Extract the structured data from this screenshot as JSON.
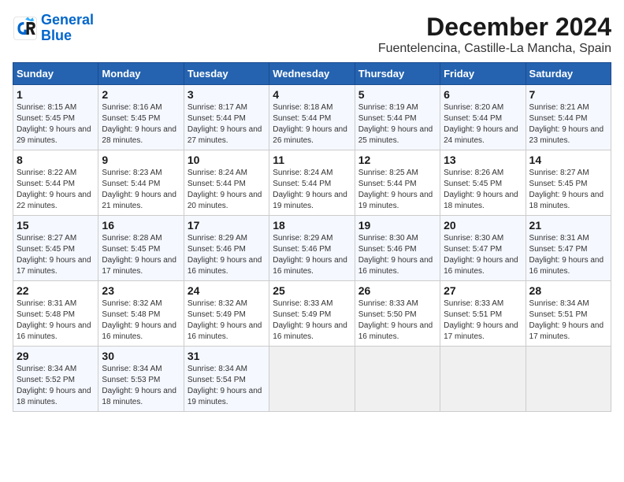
{
  "logo": {
    "line1": "General",
    "line2": "Blue"
  },
  "title": "December 2024",
  "subtitle": "Fuentelencina, Castille-La Mancha, Spain",
  "weekdays": [
    "Sunday",
    "Monday",
    "Tuesday",
    "Wednesday",
    "Thursday",
    "Friday",
    "Saturday"
  ],
  "weeks": [
    [
      {
        "day": "1",
        "sunrise": "8:15 AM",
        "sunset": "5:45 PM",
        "daylight": "9 hours and 29 minutes."
      },
      {
        "day": "2",
        "sunrise": "8:16 AM",
        "sunset": "5:45 PM",
        "daylight": "9 hours and 28 minutes."
      },
      {
        "day": "3",
        "sunrise": "8:17 AM",
        "sunset": "5:44 PM",
        "daylight": "9 hours and 27 minutes."
      },
      {
        "day": "4",
        "sunrise": "8:18 AM",
        "sunset": "5:44 PM",
        "daylight": "9 hours and 26 minutes."
      },
      {
        "day": "5",
        "sunrise": "8:19 AM",
        "sunset": "5:44 PM",
        "daylight": "9 hours and 25 minutes."
      },
      {
        "day": "6",
        "sunrise": "8:20 AM",
        "sunset": "5:44 PM",
        "daylight": "9 hours and 24 minutes."
      },
      {
        "day": "7",
        "sunrise": "8:21 AM",
        "sunset": "5:44 PM",
        "daylight": "9 hours and 23 minutes."
      }
    ],
    [
      {
        "day": "8",
        "sunrise": "8:22 AM",
        "sunset": "5:44 PM",
        "daylight": "9 hours and 22 minutes."
      },
      {
        "day": "9",
        "sunrise": "8:23 AM",
        "sunset": "5:44 PM",
        "daylight": "9 hours and 21 minutes."
      },
      {
        "day": "10",
        "sunrise": "8:24 AM",
        "sunset": "5:44 PM",
        "daylight": "9 hours and 20 minutes."
      },
      {
        "day": "11",
        "sunrise": "8:24 AM",
        "sunset": "5:44 PM",
        "daylight": "9 hours and 19 minutes."
      },
      {
        "day": "12",
        "sunrise": "8:25 AM",
        "sunset": "5:44 PM",
        "daylight": "9 hours and 19 minutes."
      },
      {
        "day": "13",
        "sunrise": "8:26 AM",
        "sunset": "5:45 PM",
        "daylight": "9 hours and 18 minutes."
      },
      {
        "day": "14",
        "sunrise": "8:27 AM",
        "sunset": "5:45 PM",
        "daylight": "9 hours and 18 minutes."
      }
    ],
    [
      {
        "day": "15",
        "sunrise": "8:27 AM",
        "sunset": "5:45 PM",
        "daylight": "9 hours and 17 minutes."
      },
      {
        "day": "16",
        "sunrise": "8:28 AM",
        "sunset": "5:45 PM",
        "daylight": "9 hours and 17 minutes."
      },
      {
        "day": "17",
        "sunrise": "8:29 AM",
        "sunset": "5:46 PM",
        "daylight": "9 hours and 16 minutes."
      },
      {
        "day": "18",
        "sunrise": "8:29 AM",
        "sunset": "5:46 PM",
        "daylight": "9 hours and 16 minutes."
      },
      {
        "day": "19",
        "sunrise": "8:30 AM",
        "sunset": "5:46 PM",
        "daylight": "9 hours and 16 minutes."
      },
      {
        "day": "20",
        "sunrise": "8:30 AM",
        "sunset": "5:47 PM",
        "daylight": "9 hours and 16 minutes."
      },
      {
        "day": "21",
        "sunrise": "8:31 AM",
        "sunset": "5:47 PM",
        "daylight": "9 hours and 16 minutes."
      }
    ],
    [
      {
        "day": "22",
        "sunrise": "8:31 AM",
        "sunset": "5:48 PM",
        "daylight": "9 hours and 16 minutes."
      },
      {
        "day": "23",
        "sunrise": "8:32 AM",
        "sunset": "5:48 PM",
        "daylight": "9 hours and 16 minutes."
      },
      {
        "day": "24",
        "sunrise": "8:32 AM",
        "sunset": "5:49 PM",
        "daylight": "9 hours and 16 minutes."
      },
      {
        "day": "25",
        "sunrise": "8:33 AM",
        "sunset": "5:49 PM",
        "daylight": "9 hours and 16 minutes."
      },
      {
        "day": "26",
        "sunrise": "8:33 AM",
        "sunset": "5:50 PM",
        "daylight": "9 hours and 16 minutes."
      },
      {
        "day": "27",
        "sunrise": "8:33 AM",
        "sunset": "5:51 PM",
        "daylight": "9 hours and 17 minutes."
      },
      {
        "day": "28",
        "sunrise": "8:34 AM",
        "sunset": "5:51 PM",
        "daylight": "9 hours and 17 minutes."
      }
    ],
    [
      {
        "day": "29",
        "sunrise": "8:34 AM",
        "sunset": "5:52 PM",
        "daylight": "9 hours and 18 minutes."
      },
      {
        "day": "30",
        "sunrise": "8:34 AM",
        "sunset": "5:53 PM",
        "daylight": "9 hours and 18 minutes."
      },
      {
        "day": "31",
        "sunrise": "8:34 AM",
        "sunset": "5:54 PM",
        "daylight": "9 hours and 19 minutes."
      },
      null,
      null,
      null,
      null
    ]
  ]
}
